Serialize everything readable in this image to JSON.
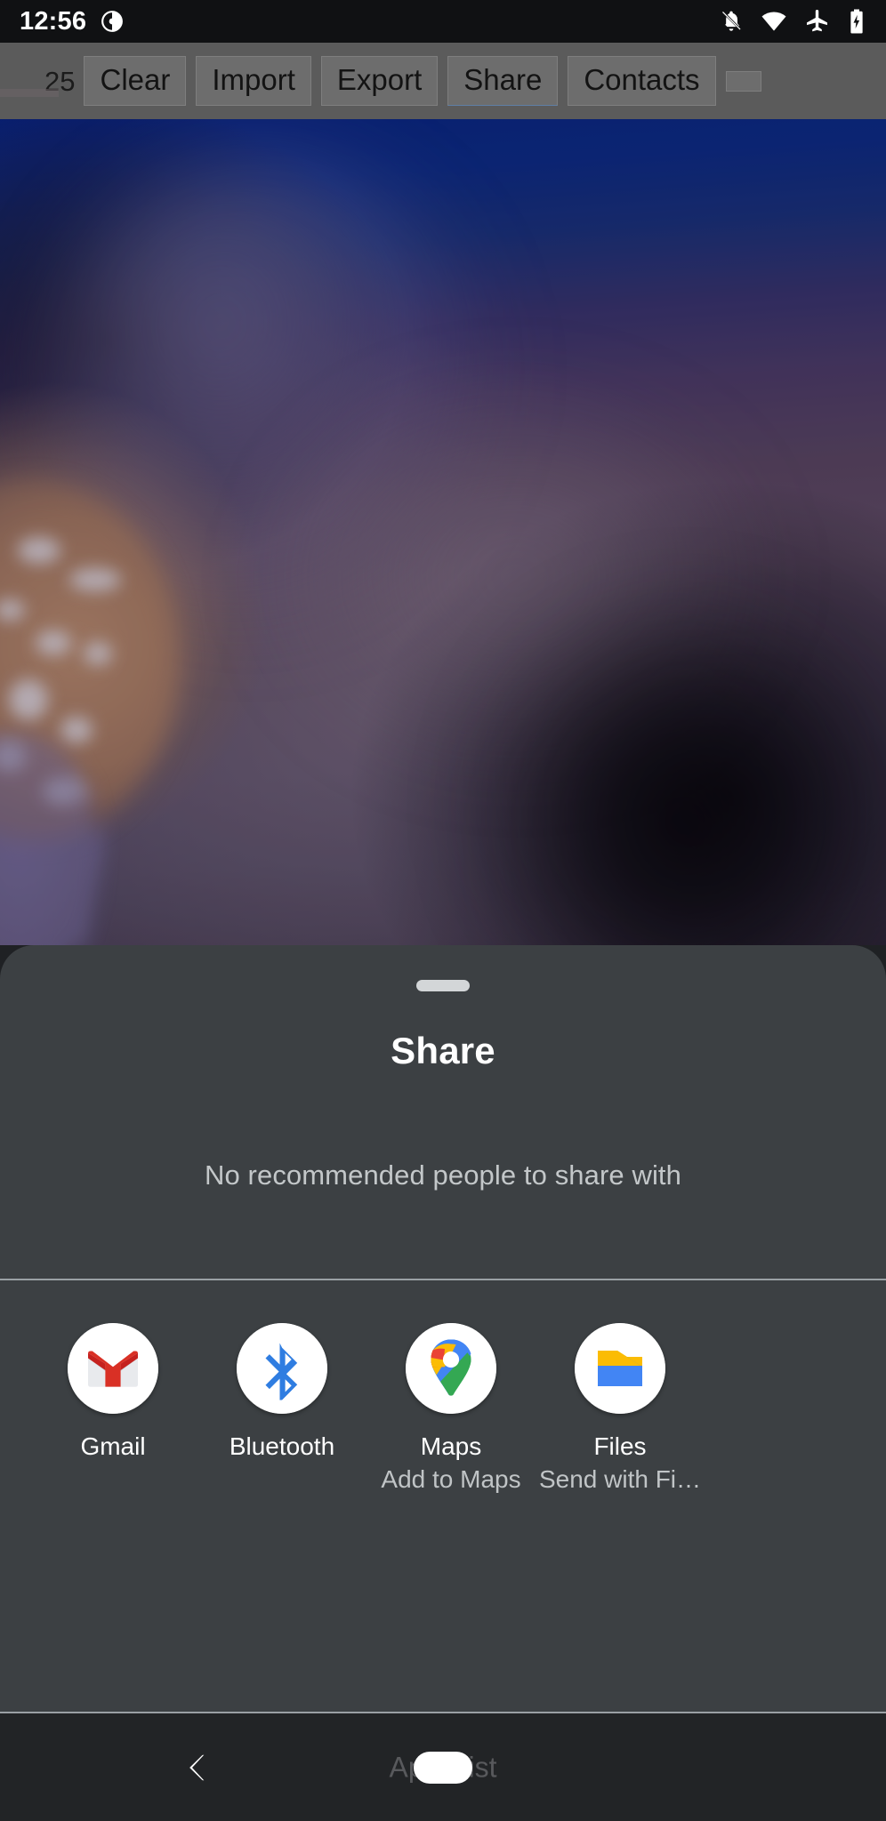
{
  "status_bar": {
    "clock": "12:56",
    "left_icons": [
      "dnd-badge-icon"
    ],
    "right_icons": [
      "notifications-off-icon",
      "wifi-icon",
      "airplane-mode-icon",
      "battery-charging-icon"
    ],
    "background_color": "#101113"
  },
  "app_toolbar": {
    "count_label": "25",
    "buttons": [
      {
        "label": "Clear",
        "active": false
      },
      {
        "label": "Import",
        "active": false
      },
      {
        "label": "Export",
        "active": false
      },
      {
        "label": "Share",
        "active": true
      },
      {
        "label": "Contacts",
        "active": false
      }
    ],
    "background_color": "#5b5b5b",
    "button_color": "#6d6d6d"
  },
  "background_photo": {
    "description": "blurred underwater photo of a spotted marine creature against deep blue water",
    "top_color": "#0a2480",
    "bottom_color": "#3f3549"
  },
  "share_sheet": {
    "title": "Share",
    "handle": "drag-handle",
    "empty_people_message": "No recommended people to share with",
    "sheet_color": "#3c4043",
    "divider_color": "#9aa0a4",
    "apps": [
      {
        "label": "Gmail",
        "sublabel": "",
        "icon": "gmail-icon",
        "colors": {
          "primary": "#d93025",
          "secondary": "#e8eaed"
        }
      },
      {
        "label": "Bluetooth",
        "sublabel": "",
        "icon": "bluetooth-icon",
        "colors": {
          "primary": "#2f7de1"
        }
      },
      {
        "label": "Maps",
        "sublabel": "Add to Maps",
        "icon": "google-maps-pin-icon",
        "colors": {
          "blue": "#4285f4",
          "red": "#ea4335",
          "yellow": "#fbbc04",
          "green": "#34a853"
        }
      },
      {
        "label": "Files",
        "sublabel": "Send with Fi…",
        "icon": "files-folder-icon",
        "colors": {
          "blue": "#4285f4",
          "green": "#34a853",
          "yellow": "#fbbc04",
          "red": "#ea4335"
        }
      }
    ]
  },
  "nav_bar": {
    "back_icon": "back-chevron-icon",
    "hint_text": "Apps list",
    "home_pill": "home-pill",
    "background_color": "#222426"
  }
}
